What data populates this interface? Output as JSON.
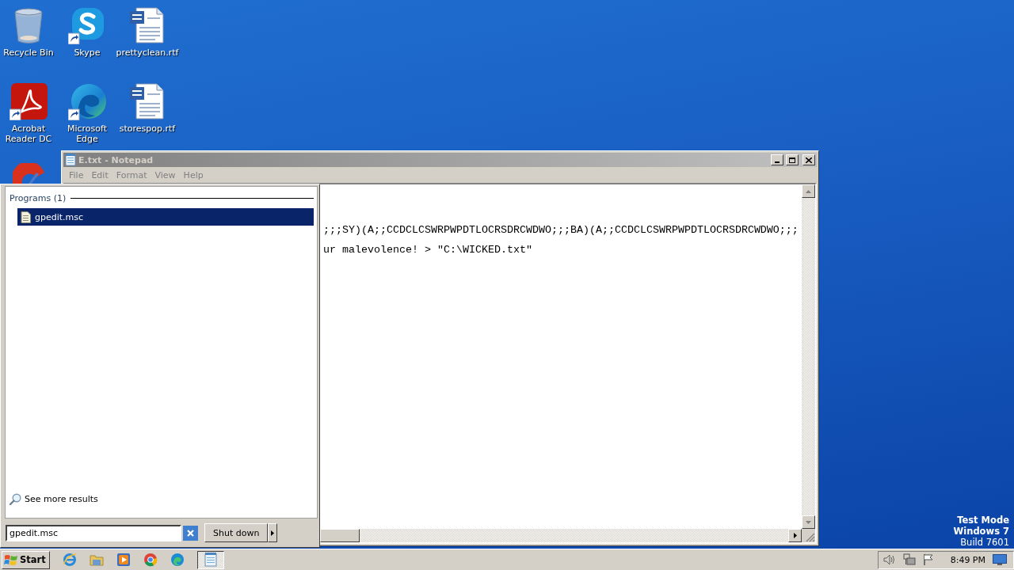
{
  "desktop": {
    "icons": [
      {
        "label": "Recycle Bin",
        "kind": "recycle",
        "shortcut": false
      },
      {
        "label": "Skype",
        "kind": "chat",
        "shortcut": true
      },
      {
        "label": "prettyclean.rtf",
        "kind": "document",
        "shortcut": false
      },
      {
        "label": "Acrobat\nReader DC",
        "kind": "pdf",
        "shortcut": true
      },
      {
        "label": "Microsoft Edge",
        "kind": "browser",
        "shortcut": true
      },
      {
        "label": "storespop.rtf",
        "kind": "document",
        "shortcut": false
      },
      {
        "kind": "cleaner"
      }
    ],
    "build_info": [
      {
        "text": "Test Mode",
        "bold": true
      },
      {
        "text": "Windows 7",
        "bold": true
      },
      {
        "text": "Build 7601",
        "bold": false
      }
    ]
  },
  "notepad": {
    "title": "E.txt - Notepad",
    "menu": [
      "File",
      "Edit",
      "Format",
      "View",
      "Help"
    ],
    "lines": [
      ";;;SY)(A;;CCDCLCSWRPWPDTLOCRSDRCWDWO;;;BA)(A;;CCDCLCSWRPWPDTLOCRSDRCWDWO;;;",
      "ur malevolence! > \"C:\\WICKED.txt\""
    ]
  },
  "start_menu": {
    "group_header": "Programs (1)",
    "results": [
      {
        "label": "gpedit.msc",
        "selected": true
      }
    ],
    "see_more": "See more results",
    "search": {
      "value": "gpedit.msc"
    },
    "shutdown_label": "Shut down"
  },
  "taskbar": {
    "start_label": "Start",
    "pinned": [
      {
        "kind": "ie"
      },
      {
        "kind": "folder"
      },
      {
        "kind": "media"
      },
      {
        "kind": "chrome"
      },
      {
        "kind": "edge"
      }
    ],
    "tasks": [
      {
        "kind": "notepad",
        "pressed": true
      }
    ],
    "clock": "8:49 PM"
  }
}
